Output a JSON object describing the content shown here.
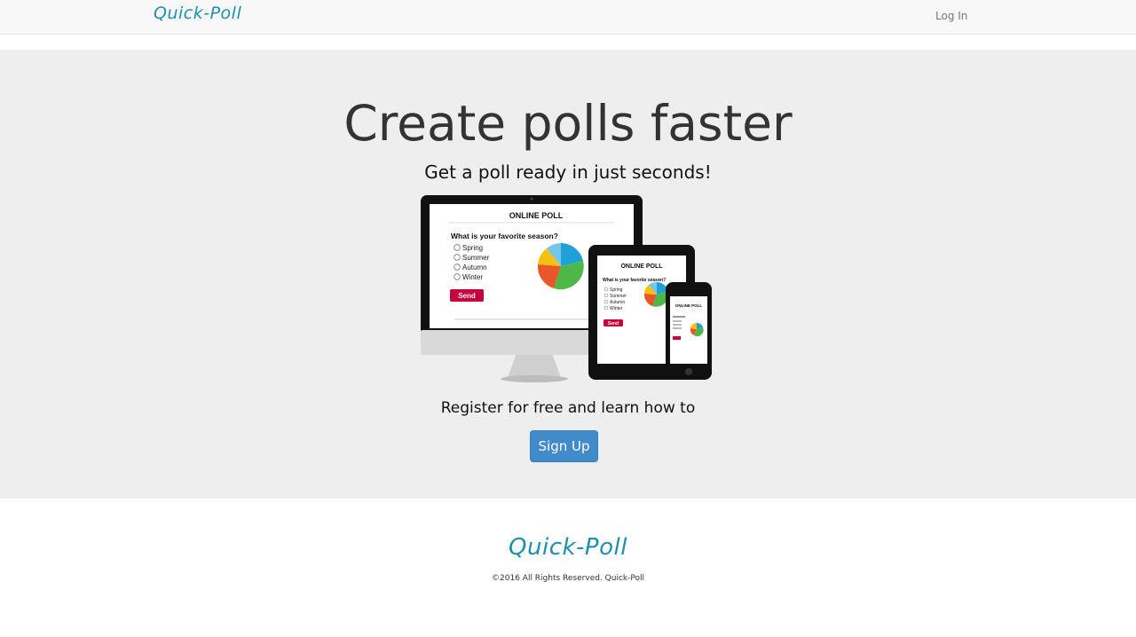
{
  "navbar": {
    "brand": "Quick-Poll",
    "login_label": "Log In"
  },
  "hero": {
    "title": "Create polls faster",
    "subtitle": "Get a poll ready in just seconds!",
    "register_text": "Register for free and learn how to",
    "signup_label": "Sign Up",
    "illustration": {
      "poll_title": "ONLINE POLL",
      "question": "What is your favorite season?",
      "options": [
        "Spring",
        "Summer",
        "Autumn",
        "Winter"
      ],
      "send_label": "Send",
      "colors": {
        "send_button": "#c8003c",
        "pie": [
          "#1fa0d8",
          "#4db848",
          "#e8572a",
          "#f4c20d",
          "#73c6e8"
        ]
      }
    }
  },
  "footer": {
    "brand": "Quick-Poll",
    "copyright": "©2016 All Rights Reserved. Quick-Poll"
  },
  "colors": {
    "brand": "#1f8fae",
    "primary_button": "#428bca",
    "hero_bg": "#eeeeee",
    "navbar_bg": "#f8f8f8"
  }
}
